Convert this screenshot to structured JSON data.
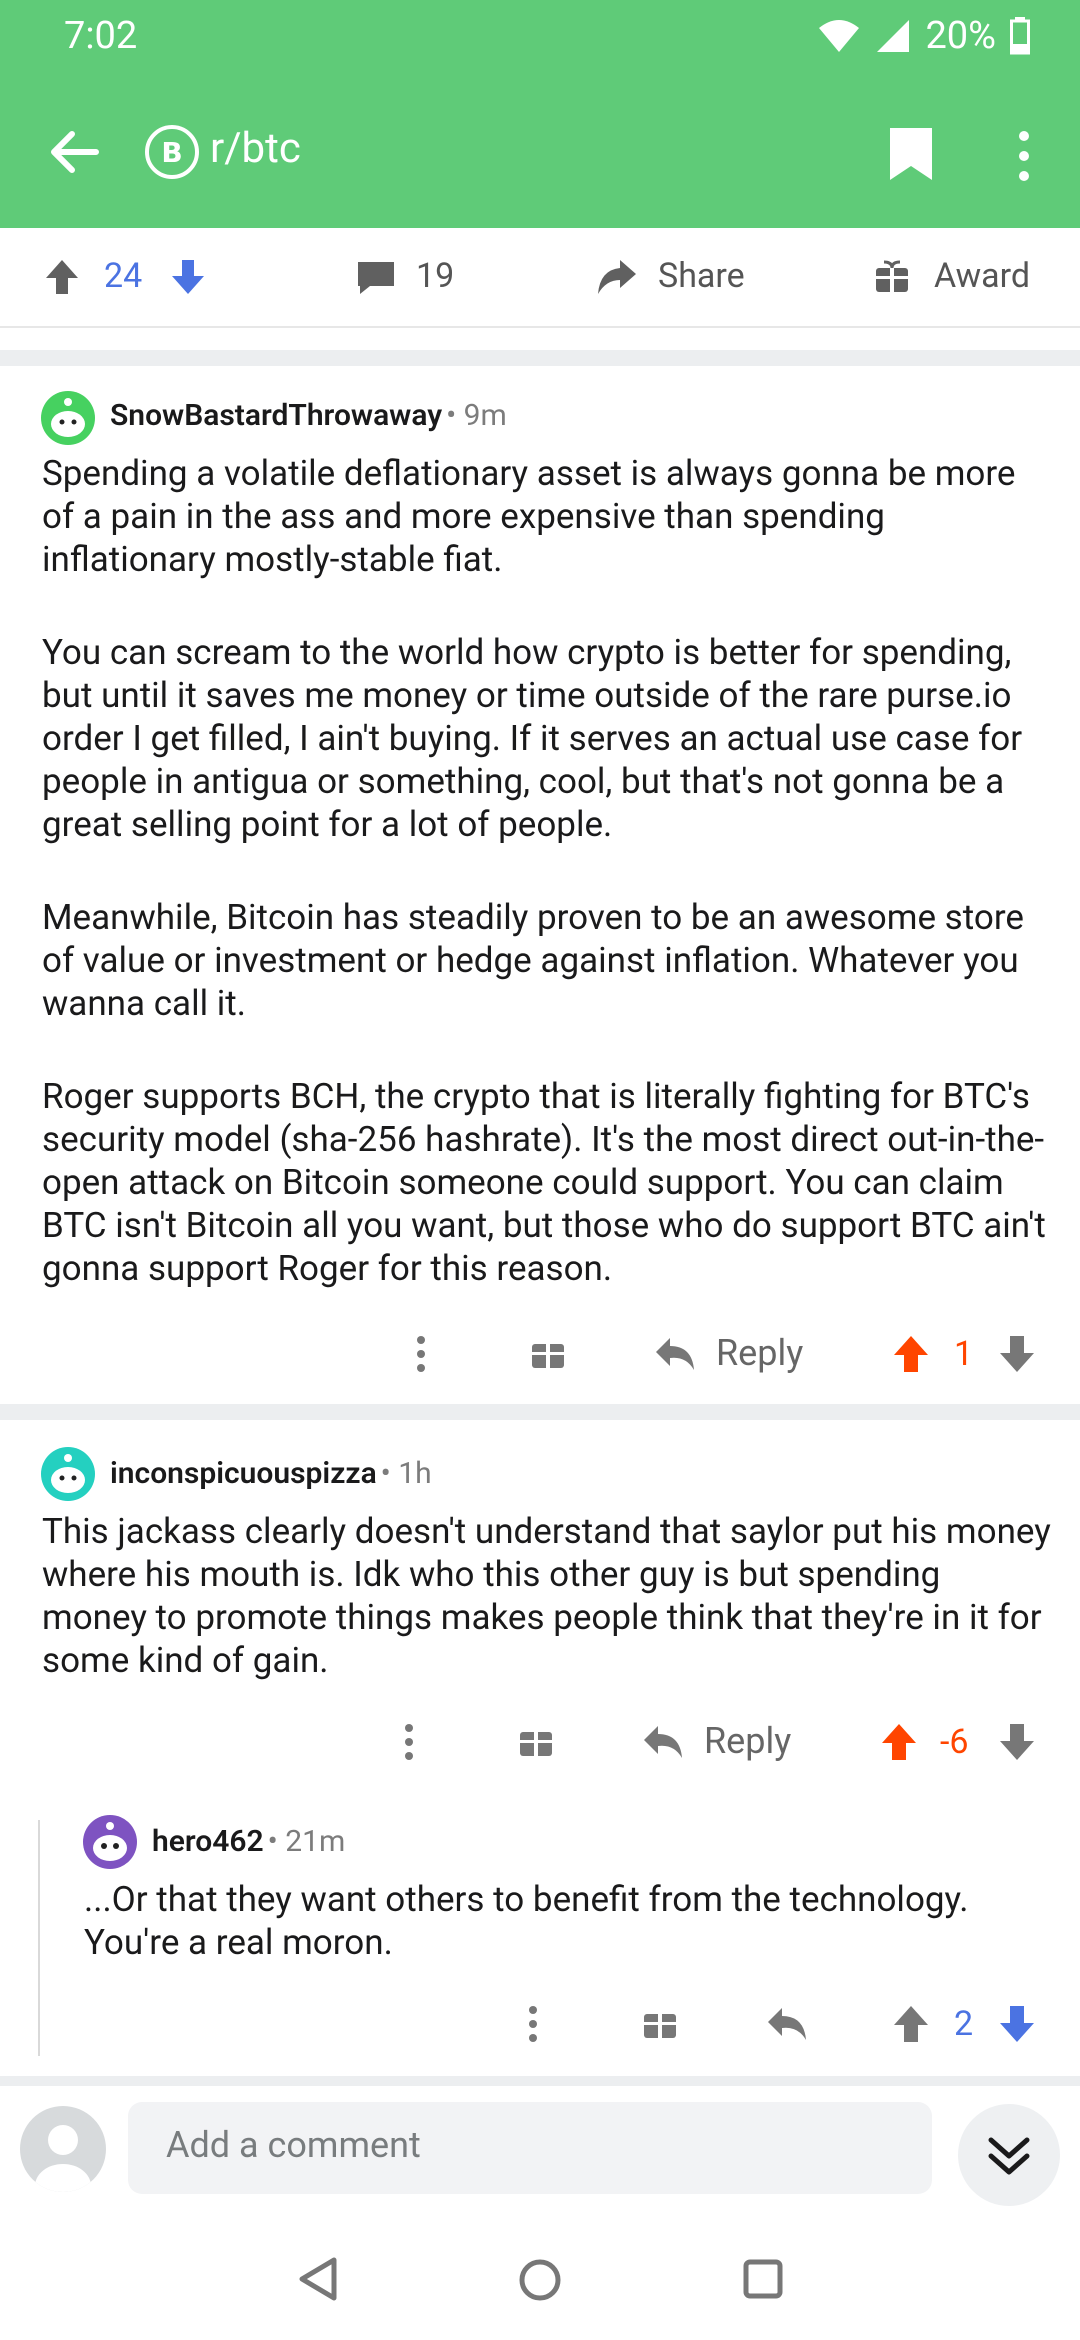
{
  "status": {
    "time": "7:02",
    "battery": "20%"
  },
  "header": {
    "subreddit": "r/btc"
  },
  "post_actions": {
    "score": "24",
    "comments": "19",
    "share": "Share",
    "award": "Award"
  },
  "comments": [
    {
      "author": "SnowBastardThrowaway",
      "time": "9m",
      "paragraphs": [
        "Spending a volatile deflationary asset is always gonna be more of a pain in the ass and more expensive than spending inflationary mostly-stable fiat.",
        "You can scream to the world how crypto is better for spending, but until it saves me money or time outside of the rare purse.io order I get filled, I ain't buying. If it serves an actual use case for people in antigua or something, cool, but that's not gonna be a great selling point for a lot of people.",
        "Meanwhile, Bitcoin has steadily proven to be an awesome store of value or investment or hedge against inflation. Whatever you wanna call it.",
        "Roger supports BCH, the crypto that is literally fighting for BTC's security model (sha-256 hashrate). It's the most direct out-in-the-open attack on Bitcoin someone could support. You can claim BTC isn't Bitcoin all you want, but those who do support BTC ain't gonna support Roger for this reason."
      ],
      "reply_label": "Reply",
      "score": "1"
    },
    {
      "author": "inconspicuouspizza",
      "time": "1h",
      "paragraphs": [
        "This jackass clearly doesn't understand that saylor put his money where his mouth is. Idk who this other guy is but spending money to promote things makes people think that they're in it for some kind of gain."
      ],
      "reply_label": "Reply",
      "score": "-6"
    },
    {
      "author": "hero462",
      "time": "21m",
      "paragraphs": [
        "...Or that they want others to benefit from the technology. You're a real moron."
      ],
      "score": "2"
    }
  ],
  "comment_bar": {
    "placeholder": "Add a comment"
  },
  "colors": {
    "header": "#5fcb78",
    "upvote": "#ff4500",
    "blue": "#4b73e2"
  },
  "icons": [
    "back-arrow-icon",
    "btc-icon",
    "bookmark-icon",
    "more-vertical-icon",
    "upvote-icon",
    "downvote-icon",
    "comment-icon",
    "share-icon",
    "award-icon",
    "reply-icon",
    "avatar-icon",
    "collapse-icon"
  ]
}
